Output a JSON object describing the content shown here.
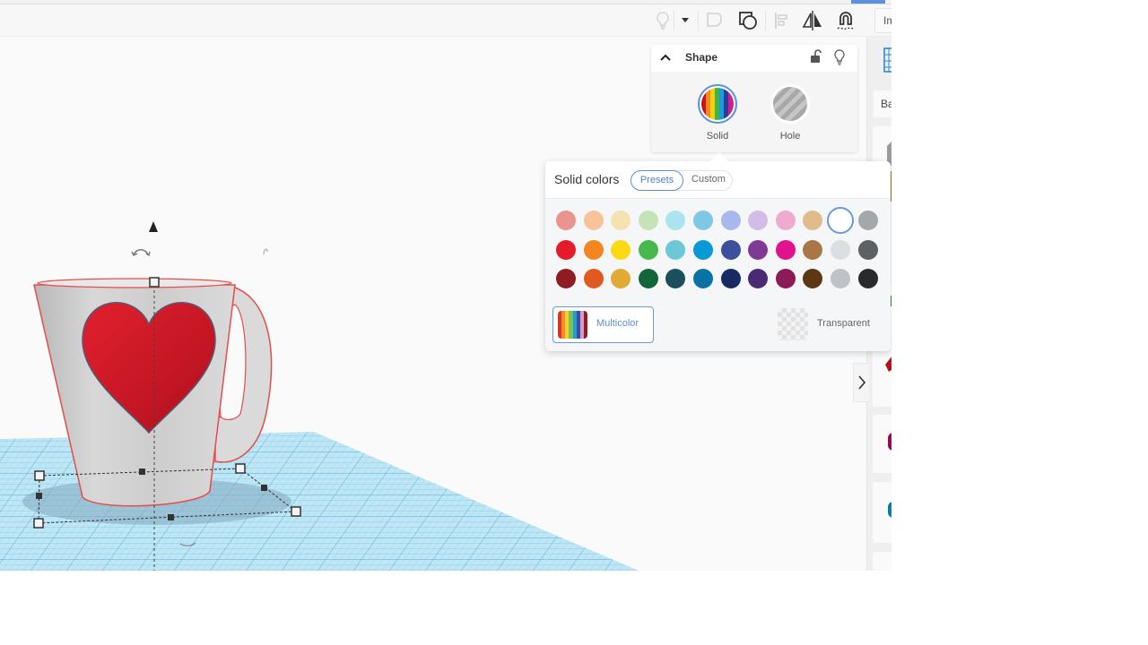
{
  "toolbar": {
    "buttons": [
      {
        "icon": "lightbulb-icon",
        "label": "Show all"
      },
      {
        "icon": "chevron-down-icon",
        "label": "Visibility options"
      },
      {
        "icon": "group-icon",
        "label": "Group"
      },
      {
        "icon": "ungroup-icon",
        "label": "Ungroup"
      },
      {
        "icon": "align-icon",
        "label": "Align"
      },
      {
        "icon": "mirror-icon",
        "label": "Mirror"
      },
      {
        "icon": "cruise-icon",
        "label": "Cruise"
      }
    ],
    "import_label": "Import"
  },
  "shape_panel": {
    "title": "Shape",
    "types": [
      {
        "label": "Solid",
        "selected": true
      },
      {
        "label": "Hole",
        "selected": false
      }
    ]
  },
  "palette": {
    "title": "Solid colors",
    "tabs": [
      {
        "label": "Presets",
        "active": true
      },
      {
        "label": "Custom",
        "active": false
      }
    ],
    "rows": [
      [
        "#e8958f",
        "#f7c49a",
        "#f6e1b0",
        "#c6e3b7",
        "#ace3ec",
        "#7ec8e3",
        "#a9b8ec",
        "#d3bde6",
        "#f0aad0",
        "#e2bb8c",
        "#ffffff",
        "#a5a8ab"
      ],
      [
        "#e31b2b",
        "#f28620",
        "#fbd914",
        "#46b84c",
        "#6cc7d6",
        "#089ad5",
        "#3a4f9d",
        "#7f3a96",
        "#e0128c",
        "#a87745",
        "#dcdfe1",
        "#5e6164"
      ],
      [
        "#8f1c22",
        "#e05a20",
        "#e1a936",
        "#12673a",
        "#1a4f5d",
        "#0973a6",
        "#172a62",
        "#4a2a74",
        "#8c1b57",
        "#5b3811",
        "#bfc3c7",
        "#282a2c"
      ]
    ],
    "selected_color": "#ffffff",
    "multicolor": {
      "label": "Multicolor",
      "stripes": [
        "#d93428",
        "#f18f26",
        "#f2d32b",
        "#7cc152",
        "#1e9bd8",
        "#3a4ea0",
        "#d99ac8",
        "#8f1c22"
      ]
    },
    "transparent_label": "Transparent"
  },
  "library": {
    "category_label": "Ba",
    "expand_icon": "chevron-right-icon"
  }
}
